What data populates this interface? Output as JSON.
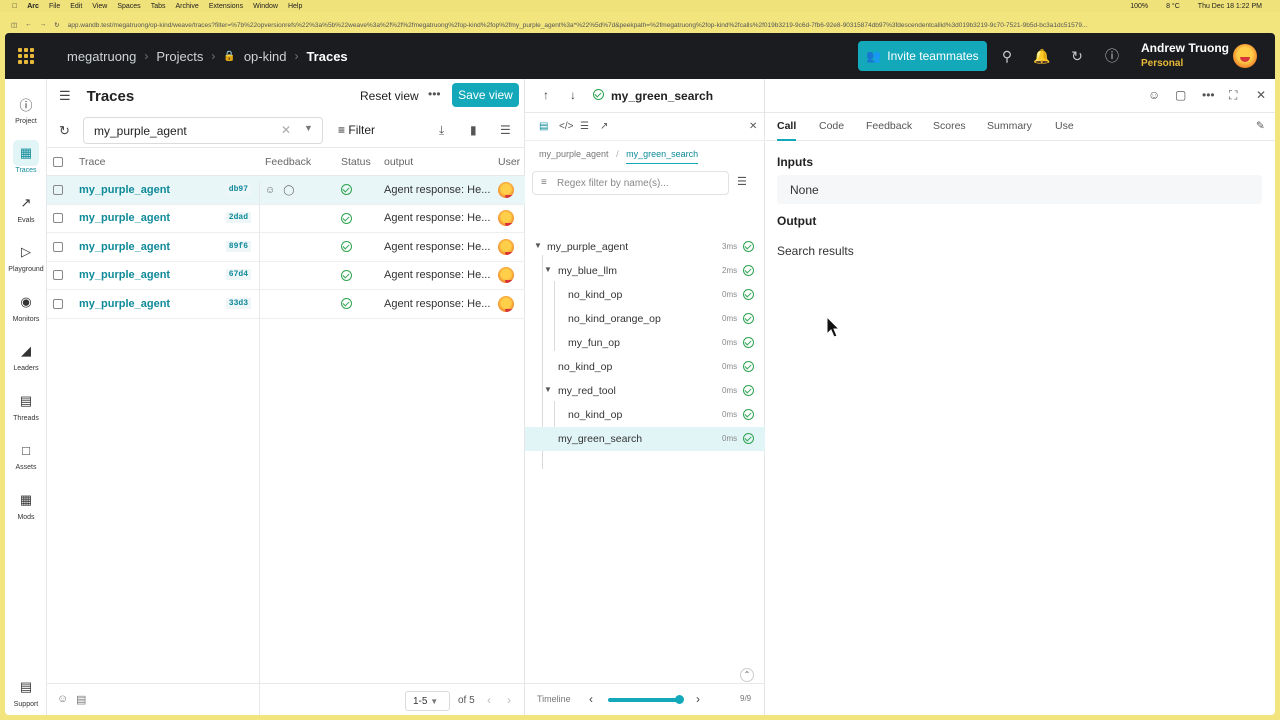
{
  "menubar": {
    "items": [
      "Arc",
      "File",
      "Edit",
      "View",
      "Spaces",
      "Tabs",
      "Archive",
      "Extensions",
      "Window",
      "Help"
    ],
    "battery": "100%",
    "weather": "8 °C",
    "clock": "Thu Dec 18  1:22 PM"
  },
  "browser": {
    "url": "app.wandb.test/megatruong/op-kind/weave/traces?filter=%7b%22opversionrefs%22%3a%5b%22weave%3a%2f%2f%2fmegatruong%2fop-kind%2fop%2fmy_purple_agent%3a*%22%5d%7d&peekpath=%2fmegatruong%2fop-kind%2fcalls%2f019b3219-9c6d-7fb6-92e8-90315874db97%3fdescendentcallid%3d019b3219-9c70-7521-9b5d-bc3a1dc51579..."
  },
  "topnav": {
    "entity": "megatruong",
    "projects": "Projects",
    "project": "op-kind",
    "page": "Traces",
    "invite_label": "Invite teammates",
    "user_name": "Andrew Truong",
    "user_sub": "Personal"
  },
  "sidebar": {
    "items": [
      {
        "label": "Project",
        "icon": "info-icon"
      },
      {
        "label": "Traces",
        "icon": "traces-icon"
      },
      {
        "label": "Evals",
        "icon": "evals-icon"
      },
      {
        "label": "Playground",
        "icon": "playground-icon"
      },
      {
        "label": "Monitors",
        "icon": "monitors-icon"
      },
      {
        "label": "Leaders",
        "icon": "leaders-icon"
      },
      {
        "label": "Threads",
        "icon": "threads-icon"
      },
      {
        "label": "Assets",
        "icon": "assets-icon"
      },
      {
        "label": "Mods",
        "icon": "mods-icon"
      },
      {
        "label": "Support",
        "icon": "support-icon"
      }
    ]
  },
  "traces": {
    "title": "Traces",
    "reset_label": "Reset view",
    "save_label": "Save view",
    "search_value": "my_purple_agent",
    "filter_label": "Filter",
    "columns": [
      "Trace",
      "Feedback",
      "Status",
      "output",
      "User"
    ],
    "rows": [
      {
        "name": "my_purple_agent",
        "hash": "db97",
        "output": "Agent response: He..."
      },
      {
        "name": "my_purple_agent",
        "hash": "2dad",
        "output": "Agent response: He..."
      },
      {
        "name": "my_purple_agent",
        "hash": "89f6",
        "output": "Agent response: He..."
      },
      {
        "name": "my_purple_agent",
        "hash": "67d4",
        "output": "Agent response: He..."
      },
      {
        "name": "my_purple_agent",
        "hash": "33d3",
        "output": "Agent response: He..."
      }
    ],
    "page_range": "1-5",
    "page_of": "of 5"
  },
  "peek": {
    "title": "my_green_search",
    "breadcrumb": [
      "my_purple_agent",
      "my_green_search"
    ],
    "regex_placeholder": "Regex filter by name(s)...",
    "tree": [
      {
        "name": "my_purple_agent",
        "time": "3ms",
        "depth": 0,
        "chevron": true
      },
      {
        "name": "my_blue_llm",
        "time": "2ms",
        "depth": 1,
        "chevron": true
      },
      {
        "name": "no_kind_op",
        "time": "0ms",
        "depth": 2,
        "chevron": false
      },
      {
        "name": "no_kind_orange_op",
        "time": "0ms",
        "depth": 2,
        "chevron": false
      },
      {
        "name": "my_fun_op",
        "time": "0ms",
        "depth": 2,
        "chevron": false
      },
      {
        "name": "no_kind_op",
        "time": "0ms",
        "depth": 1,
        "chevron": false
      },
      {
        "name": "my_red_tool",
        "time": "0ms",
        "depth": 1,
        "chevron": true
      },
      {
        "name": "no_kind_op",
        "time": "0ms",
        "depth": 2,
        "chevron": false
      },
      {
        "name": "my_green_search",
        "time": "0ms",
        "depth": 1,
        "chevron": false,
        "selected": true
      }
    ],
    "timeline_label": "Timeline",
    "timeline_count": "9/9",
    "timeline_progress": 0.95
  },
  "detail": {
    "tabs": [
      "Call",
      "Code",
      "Feedback",
      "Scores",
      "Summary",
      "Use"
    ],
    "active_tab": "Call",
    "inputs_label": "Inputs",
    "inputs_value": "None",
    "output_label": "Output",
    "output_value": "Search results"
  },
  "colors": {
    "accent": "#13a9ba",
    "nav_bg": "#1a1c1f",
    "success": "#2ea44f",
    "brand": "#e8b93a"
  }
}
